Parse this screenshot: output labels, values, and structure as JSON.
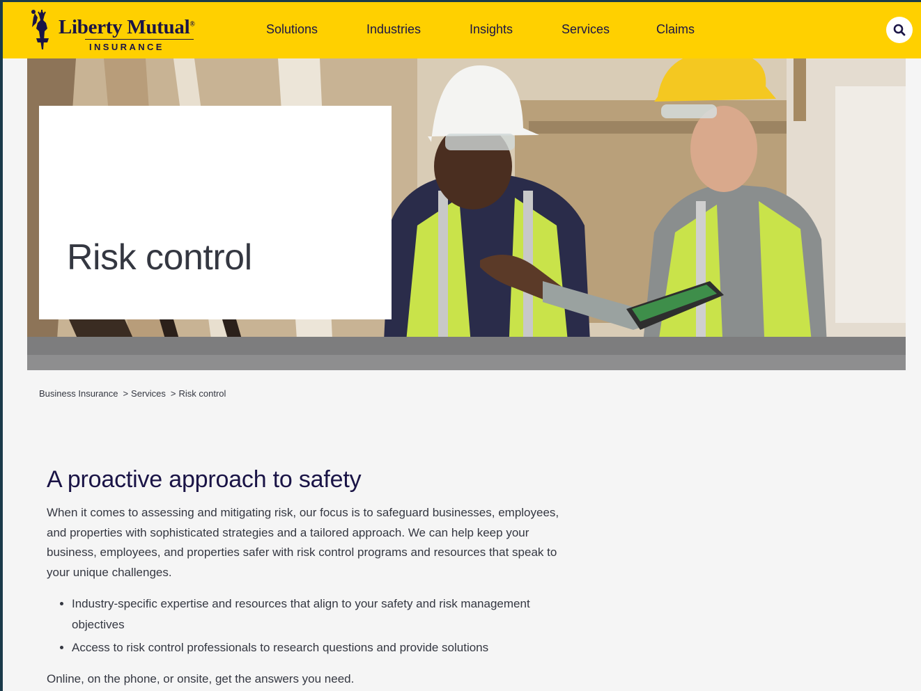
{
  "brand": {
    "name": "Liberty Mutual",
    "sub": "INSURANCE",
    "colors": {
      "primary": "#ffd000",
      "navy": "#1a1446",
      "text": "#343741"
    }
  },
  "nav": {
    "items": [
      "Solutions",
      "Industries",
      "Insights",
      "Services",
      "Claims"
    ],
    "search_icon": "search-icon"
  },
  "hero": {
    "title": "Risk control"
  },
  "breadcrumb": {
    "items": [
      "Business Insurance",
      "Services",
      "Risk control"
    ],
    "separator": ">"
  },
  "main": {
    "heading": "A proactive approach to safety",
    "intro": "When it comes to assessing and mitigating risk, our focus is to safeguard businesses, employees, and properties with sophisticated strategies and a tailored approach. We can help keep your business, employees, and properties safer with risk control programs and resources that speak to your unique challenges.",
    "bullets": [
      "Industry-specific expertise and resources that align to your safety and risk management objectives",
      "Access to risk control professionals to research questions and provide solutions"
    ],
    "closing": "Online, on the phone, or onsite, get the answers you need."
  }
}
